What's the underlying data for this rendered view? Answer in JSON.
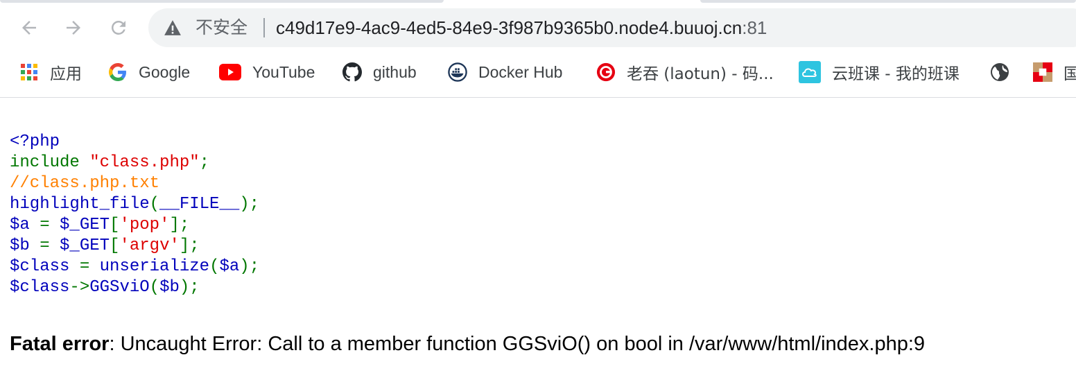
{
  "browser": {
    "security_label": "不安全",
    "url_host": "c49d17e9-4ac9-4ed5-84e9-3f987b9365b0.node4.buuoj.cn",
    "url_port": ":81"
  },
  "bookmarks": [
    {
      "label": "应用",
      "icon": "apps-grid-icon"
    },
    {
      "label": "Google",
      "icon": "google-icon"
    },
    {
      "label": "YouTube",
      "icon": "youtube-icon"
    },
    {
      "label": "github",
      "icon": "github-icon"
    },
    {
      "label": "Docker Hub",
      "icon": "docker-icon"
    },
    {
      "label": "老吞 (laotun) - 码...",
      "icon": "laotun-icon"
    },
    {
      "label": "云班课 - 我的班课",
      "icon": "cloud-class-icon"
    },
    {
      "label": "",
      "icon": "globe-icon"
    },
    {
      "label": "国",
      "icon": "bookmark-site-icon"
    }
  ],
  "code_lines": [
    "<?php",
    "include \"class.php\";",
    "//class.php.txt",
    "highlight_file(__FILE__);",
    "$a = $_GET['pop'];",
    "$b = $_GET['argv'];",
    "$class = unserialize($a);",
    "$class->GGSviO($b);"
  ],
  "code_tokens": {
    "open_tag": "<?php",
    "include_kw": "include ",
    "include_str": "\"class.php\"",
    "semi": ";",
    "comment": "//class.php.txt",
    "hf_fn": "highlight_file",
    "paren_open": "(",
    "file_const": "__FILE__",
    "paren_close_semi": ");",
    "var_a": "$a ",
    "eq": "= ",
    "get": "$_GET",
    "bracket_open": "[",
    "key_pop": "'pop'",
    "bracket_close_semi": "];",
    "var_b": "$b ",
    "key_argv": "'argv'",
    "var_class": "$class ",
    "unserialize_fn": "unserialize",
    "arg_a": "$a",
    "class_obj": "$class",
    "arrow": "->",
    "method": "GGSviO",
    "arg_b": "$b"
  },
  "error": {
    "title": "Fatal error",
    "message": ": Uncaught Error: Call to a member function GGSviO() on bool in /var/www/html/index.php:9"
  },
  "colors": {
    "php_default": "#0000bb",
    "php_keyword": "#007700",
    "php_string": "#dd0000",
    "php_comment": "#ff8000"
  }
}
